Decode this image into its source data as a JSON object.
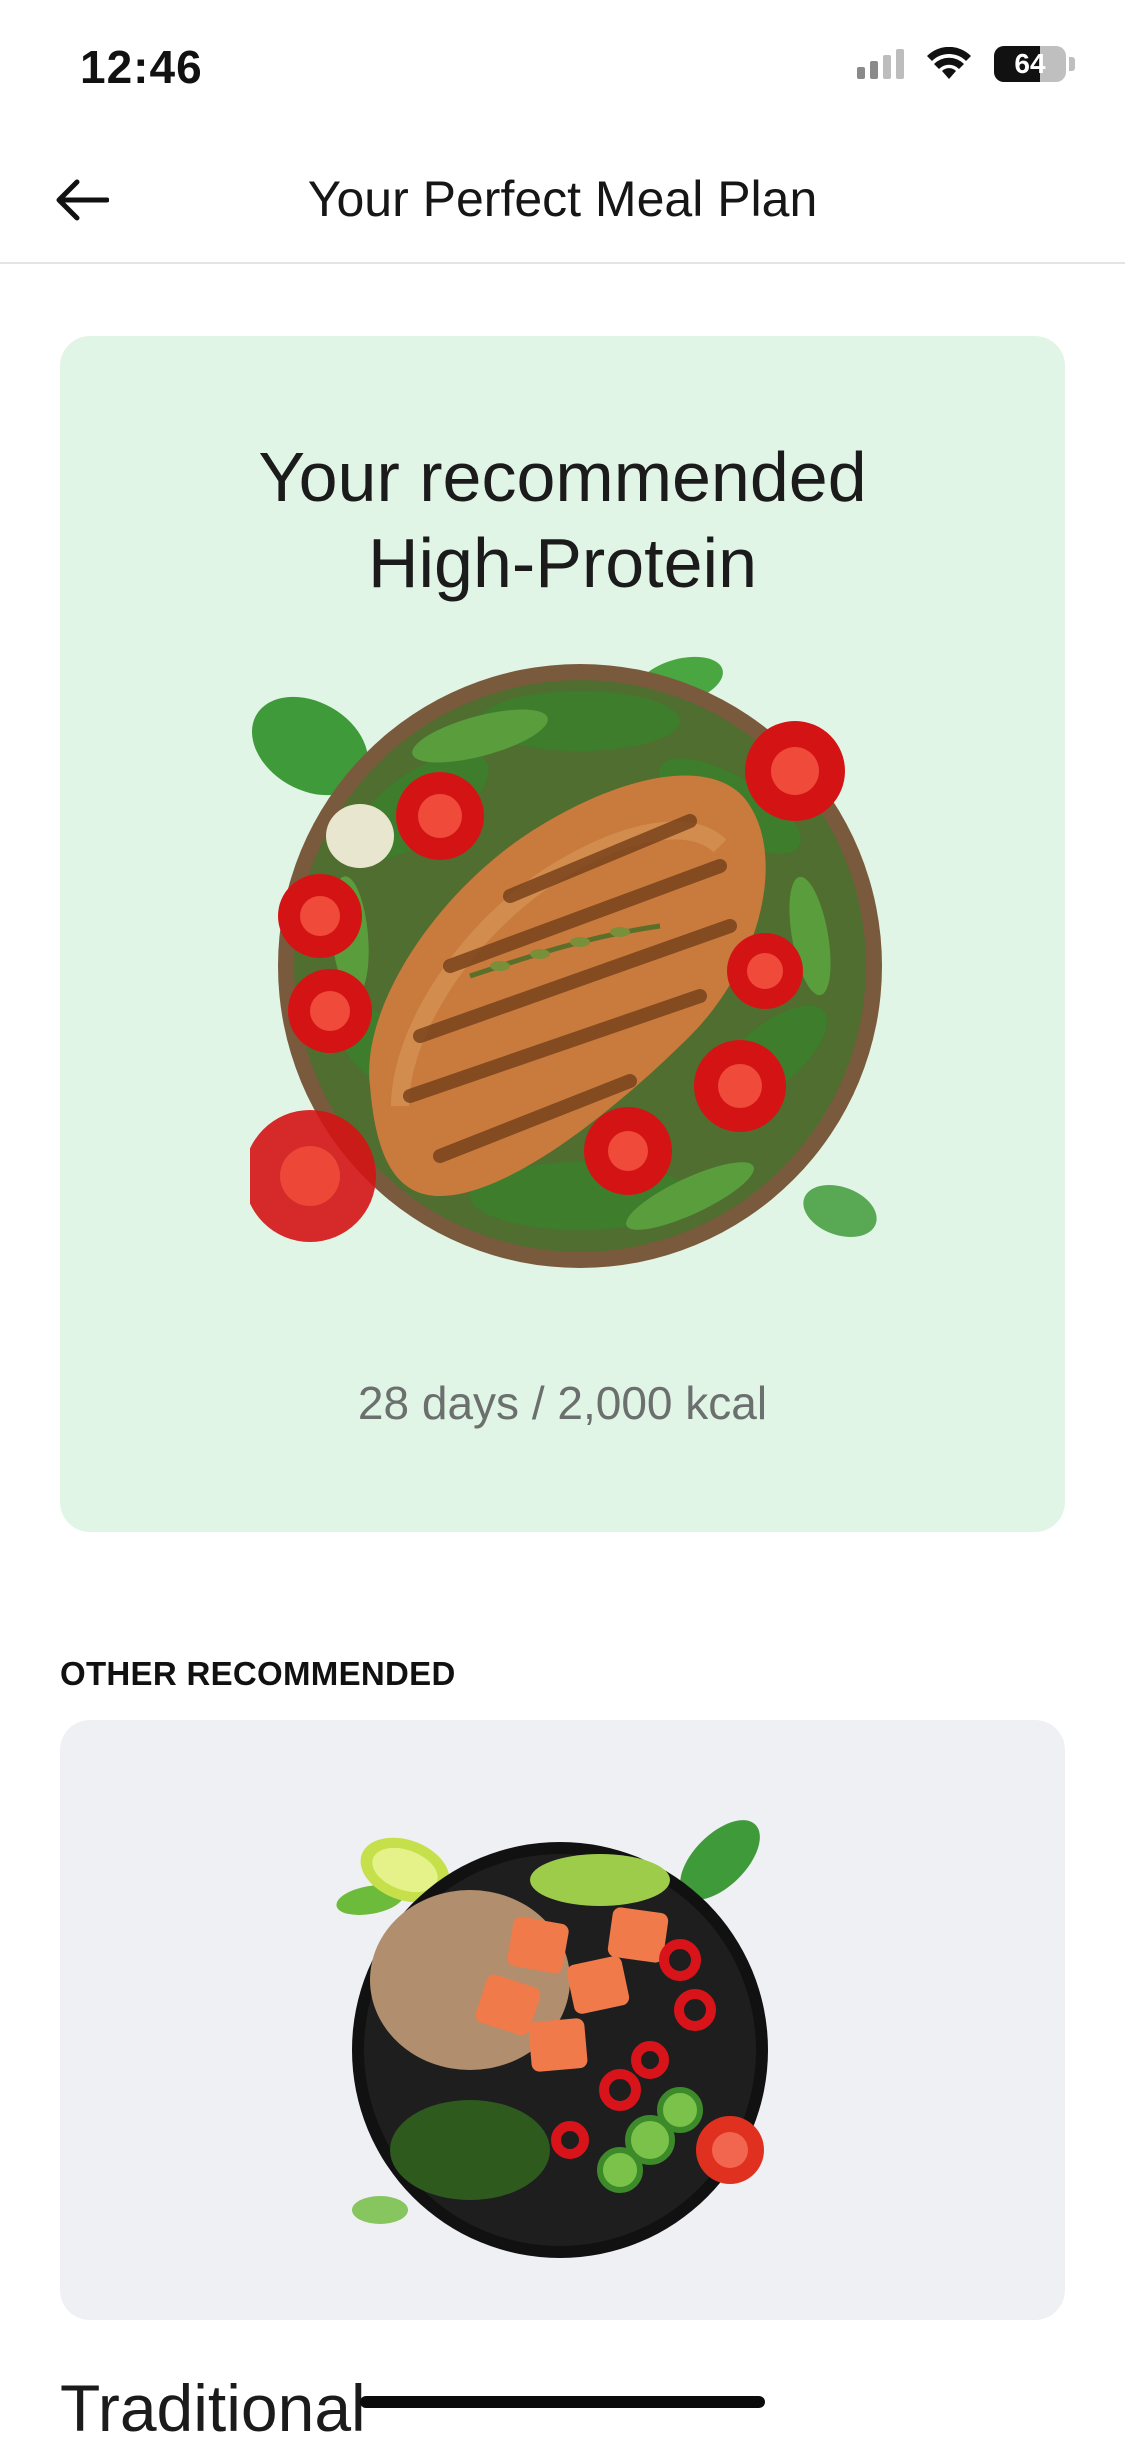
{
  "status_bar": {
    "time": "12:46",
    "battery_level": "64"
  },
  "header": {
    "title": "Your Perfect Meal Plan"
  },
  "hero": {
    "title_line1": "Your recommended",
    "title_line2": "High-Protein",
    "meta": "28 days / 2,000 kcal",
    "background": "#e1f5e7"
  },
  "other": {
    "section_label": "OTHER RECOMMENDED",
    "card_title": "Traditional",
    "background": "#eff0f4"
  }
}
